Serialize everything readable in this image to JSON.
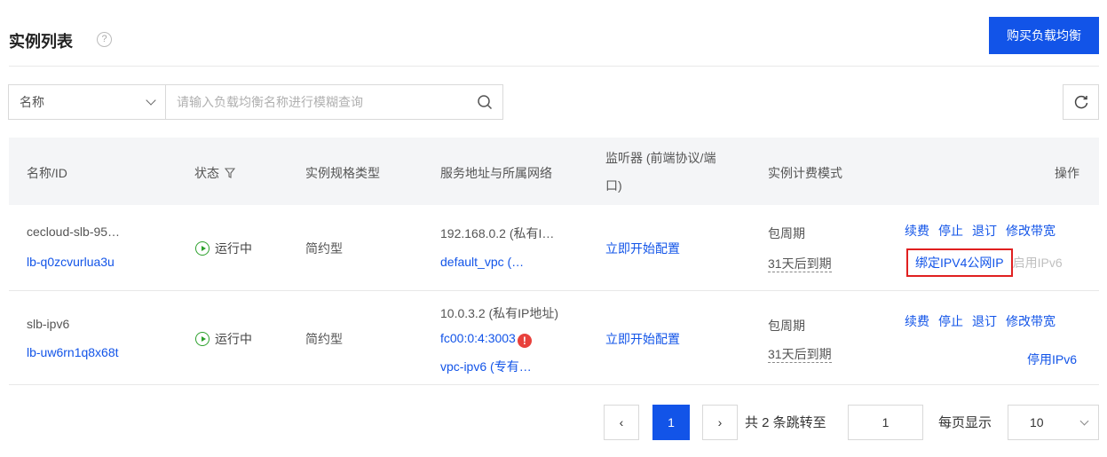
{
  "header": {
    "title": "实例列表",
    "help_glyph": "?",
    "buy_button": "购买负载均衡"
  },
  "search": {
    "field_label": "名称",
    "placeholder": "请输入负载均衡名称进行模糊查询"
  },
  "table": {
    "columns": [
      "名称/ID",
      "状态",
      "实例规格类型",
      "服务地址与所属网络",
      "监听器 (前端协议/端",
      "口)",
      "实例计费模式",
      "操作"
    ],
    "rows": [
      {
        "name": "cecloud-slb-95…",
        "id": "lb-q0zcvurlua3u",
        "status": "运行中",
        "spec": "简约型",
        "address_line1": "192.168.0.2 (私有I…",
        "address_line2_link": "default_vpc",
        "address_line2_suffix": " (…",
        "listener": "立即开始配置",
        "billing": "包周期",
        "expire": "31天后到期",
        "ops": [
          "续费",
          "停止",
          "退订",
          "修改带宽"
        ],
        "ops2_highlight": "绑定IPV4公网IP",
        "ops2_gray": "启用IPv6"
      },
      {
        "name": "slb-ipv6",
        "id": "lb-uw6rn1q8x68t",
        "status": "运行中",
        "spec": "简约型",
        "address_line1": "10.0.3.2 (私有IP地址)",
        "address_line2_link": "fc00:0:4:3003",
        "warn_glyph": "!",
        "address_line3_link": "vpc-ipv6",
        "address_line3_suffix": " (专有…",
        "listener": "立即开始配置",
        "billing": "包周期",
        "expire": "31天后到期",
        "ops": [
          "续费",
          "停止",
          "退订",
          "修改带宽"
        ],
        "ops2_link": "停用IPv6"
      }
    ]
  },
  "pagination": {
    "prev": "‹",
    "current": "1",
    "next": "›",
    "total_text": "共 2 条跳转至",
    "jump_value": "1",
    "per_page_label": "每页显示",
    "per_page_value": "10"
  },
  "colors": {
    "primary": "#1254e8",
    "running": "#2ca02c",
    "highlight_border": "#e02020",
    "warning": "#e8413c"
  }
}
